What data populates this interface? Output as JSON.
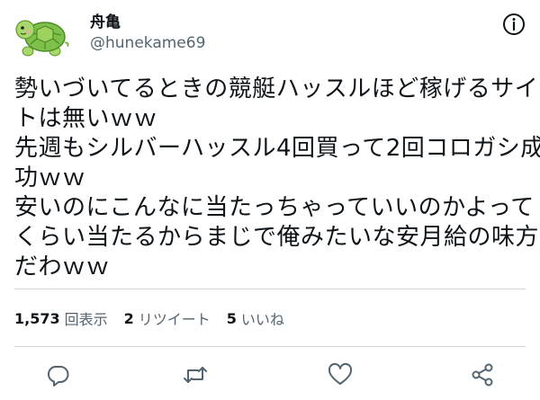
{
  "user": {
    "name": "舟亀",
    "handle": "@hunekame69"
  },
  "tweet": {
    "lines": [
      "勢いづいてるときの競艇ハッスルほど稼げるサイ",
      "トは無いｗｗ",
      "先週もシルバーハッスル4回買って2回コロガシ成",
      "功ｗｗ",
      "安いのにこんなに当たっちゃっていいのかよって",
      "くらい当たるからまじで俺みたいな安月給の味方",
      "だわｗｗ"
    ]
  },
  "stats": {
    "views_count": "1,573",
    "views_label": "回表示",
    "retweets_count": "2",
    "retweets_label": "リツイート",
    "likes_count": "5",
    "likes_label": "いいね"
  },
  "icons": {
    "avatar": "turtle-avatar",
    "info": "info-circle-icon",
    "reply": "reply-icon",
    "retweet": "retweet-icon",
    "like": "heart-icon",
    "share": "share-icon"
  },
  "colors": {
    "text": "#0f1419",
    "secondary": "#536471",
    "divider": "#cfd9de",
    "avatar_green": "#7dc04b"
  }
}
